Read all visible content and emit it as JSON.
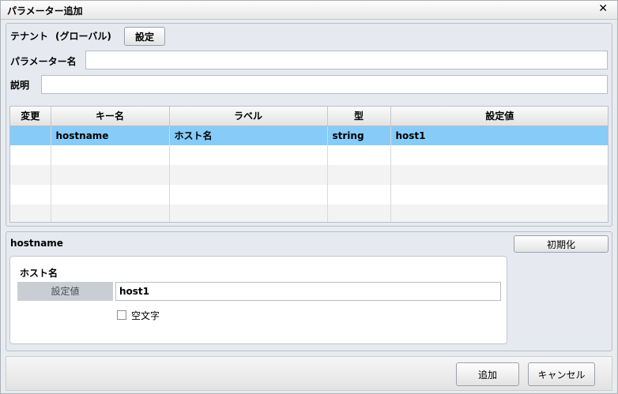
{
  "window": {
    "title": "パラメーター追加",
    "close_glyph": "✕"
  },
  "form": {
    "tenant_label": "テナント",
    "tenant_value": "(グローバル)",
    "settings_button": "設定",
    "param_name_label": "パラメーター名",
    "param_name_value": "",
    "description_label": "説明",
    "description_value": ""
  },
  "table": {
    "headers": [
      "変更",
      "キー名",
      "ラベル",
      "型",
      "設定値"
    ],
    "rows": [
      {
        "changed": "",
        "key": "hostname",
        "label": "ホスト名",
        "type": "string",
        "value": "host1"
      }
    ]
  },
  "detail": {
    "key": "hostname",
    "reset_button": "初期化",
    "label": "ホスト名",
    "value_label": "設定値",
    "value": "host1",
    "empty_string_label": "空文字",
    "empty_string_checked": false
  },
  "footer": {
    "add_button": "追加",
    "cancel_button": "キャンセル"
  },
  "colors": {
    "selected_row": "#87cbf9",
    "panel_bg": "#e6eaf0"
  }
}
